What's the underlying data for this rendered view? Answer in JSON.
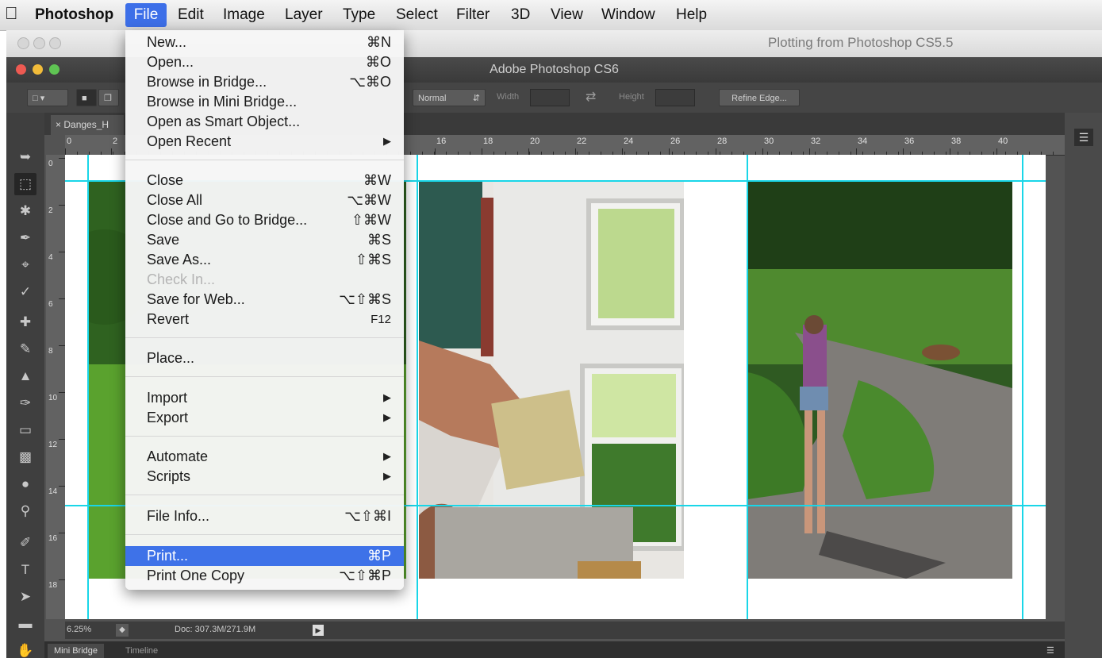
{
  "menubar": {
    "apple_icon": "apple-icon",
    "app_name": "Photoshop",
    "items": [
      "File",
      "Edit",
      "Image",
      "Layer",
      "Type",
      "Select",
      "Filter",
      "3D",
      "View",
      "Window",
      "Help"
    ]
  },
  "background_window": {
    "title": "Plotting from Photoshop CS5.5"
  },
  "window": {
    "title": "Adobe Photoshop CS6"
  },
  "options_bar": {
    "mode_value": "Normal",
    "width_label": "Width",
    "height_label": "Height",
    "refine_edge_label": "Refine Edge..."
  },
  "document_tab": {
    "label": "Danges_H"
  },
  "ruler": {
    "top_labels": [
      "0",
      "2",
      "16",
      "18",
      "20",
      "22",
      "24",
      "26",
      "28",
      "30",
      "32",
      "34",
      "36",
      "38",
      "40"
    ],
    "left_labels": [
      "0",
      "2",
      "4",
      "6",
      "8",
      "10",
      "12",
      "14",
      "16",
      "18"
    ]
  },
  "file_menu": {
    "items": [
      {
        "label": "New...",
        "shortcut": "⌘N"
      },
      {
        "label": "Open...",
        "shortcut": "⌘O"
      },
      {
        "label": "Browse in Bridge...",
        "shortcut": "⌥⌘O"
      },
      {
        "label": "Browse in Mini Bridge...",
        "shortcut": ""
      },
      {
        "label": "Open as Smart Object...",
        "shortcut": ""
      },
      {
        "label": "Open Recent",
        "shortcut": "",
        "submenu": true
      },
      {
        "label": "Close",
        "shortcut": "⌘W"
      },
      {
        "label": "Close All",
        "shortcut": "⌥⌘W"
      },
      {
        "label": "Close and Go to Bridge...",
        "shortcut": "⇧⌘W"
      },
      {
        "label": "Save",
        "shortcut": "⌘S"
      },
      {
        "label": "Save As...",
        "shortcut": "⇧⌘S"
      },
      {
        "label": "Check In...",
        "shortcut": "",
        "disabled": true
      },
      {
        "label": "Save for Web...",
        "shortcut": "⌥⇧⌘S"
      },
      {
        "label": "Revert",
        "shortcut": "F12"
      },
      {
        "label": "Place...",
        "shortcut": ""
      },
      {
        "label": "Import",
        "shortcut": "",
        "submenu": true
      },
      {
        "label": "Export",
        "shortcut": "",
        "submenu": true
      },
      {
        "label": "Automate",
        "shortcut": "",
        "submenu": true
      },
      {
        "label": "Scripts",
        "shortcut": "",
        "submenu": true
      },
      {
        "label": "File Info...",
        "shortcut": "⌥⇧⌘I"
      },
      {
        "label": "Print...",
        "shortcut": "⌘P",
        "highlighted": true
      },
      {
        "label": "Print One Copy",
        "shortcut": "⌥⇧⌘P"
      }
    ]
  },
  "status_bar": {
    "zoom": "6.25%",
    "doc_size": "Doc: 307.3M/271.9M"
  },
  "bottom_tabs": [
    "Mini Bridge",
    "Timeline"
  ],
  "colors": {
    "menu_highlight": "#3e72e8",
    "guide": "#19d6e8",
    "ps_background": "#535353"
  }
}
